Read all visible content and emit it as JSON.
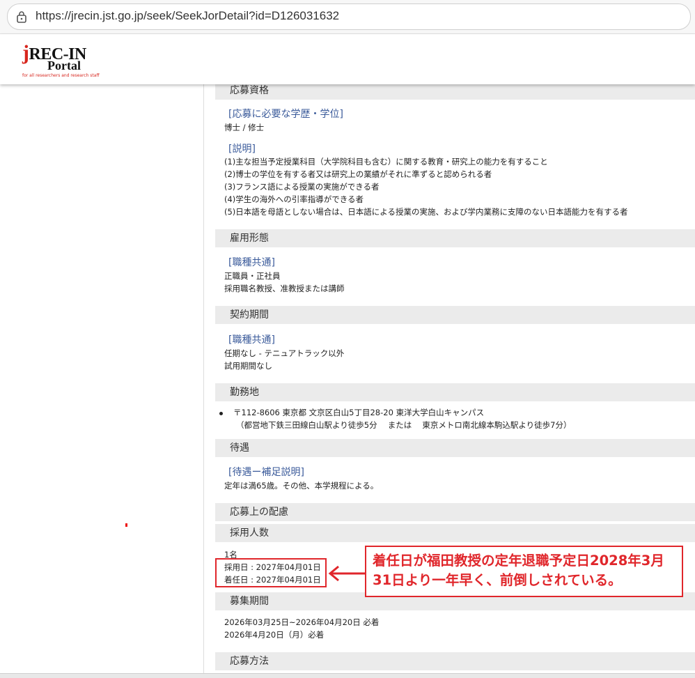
{
  "browser": {
    "url": "https://jrecin.jst.go.jp/seek/SeekJorDetail?id=D126031632"
  },
  "logo": {
    "main_j": "j",
    "main_rest": "REC-IN",
    "sub": "Portal",
    "tagline": "for all researchers and research staff"
  },
  "sections": {
    "qualification": {
      "title": "応募資格",
      "degree_label": "[応募に必要な学歴・学位]",
      "degree_value": "博士 / 修士",
      "explain_label": "[説明]",
      "lines": [
        "(1)主な担当予定授業科目（大学院科目も含む）に関する教育・研究上の能力を有すること",
        "(2)博士の学位を有する者又は研究上の業績がそれに準ずると認められる者",
        "(3)フランス語による授業の実施ができる者",
        "(4)学生の海外への引率指導ができる者",
        "(5)日本語を母語としない場合は、日本語による授業の実施、および学内業務に支障のない日本語能力を有する者"
      ]
    },
    "employment": {
      "title": "雇用形態",
      "label": "[職種共通]",
      "lines": [
        "正職員・正社員",
        "採用職名教授、准教授または講師"
      ]
    },
    "contract": {
      "title": "契約期間",
      "label": "[職種共通]",
      "lines": [
        "任期なし - テニュアトラック以外",
        "試用期間なし"
      ]
    },
    "location": {
      "title": "勤務地",
      "line1": "〒112-8606 東京都 文京区白山5丁目28-20 東洋大学白山キャンパス",
      "line2": "（都営地下鉄三田線白山駅より徒歩5分　 または　 東京メトロ南北線本駒込駅より徒歩7分）"
    },
    "treatment": {
      "title": "待遇",
      "label": "[待遇ー補足説明]",
      "line": "定年は満65歳。その他、本学規程による。"
    },
    "considerations": {
      "title": "応募上の配慮"
    },
    "hires": {
      "title": "採用人数",
      "count": "1名",
      "hire_date": "採用日 : 2027年04月01日",
      "start_date": "着任日 : 2027年04月01日"
    },
    "period": {
      "title": "募集期間",
      "line1": "2026年03月25日~2026年04月20日 必着",
      "line2": "2026年4月20日（月）必着"
    },
    "method": {
      "title": "応募方法"
    }
  },
  "annotation": {
    "line1": "着任日が福田教授の定年退職予定日2028年3月",
    "line2": "31日より一年早く、前倒しされている。",
    "color": "#e0262b"
  }
}
